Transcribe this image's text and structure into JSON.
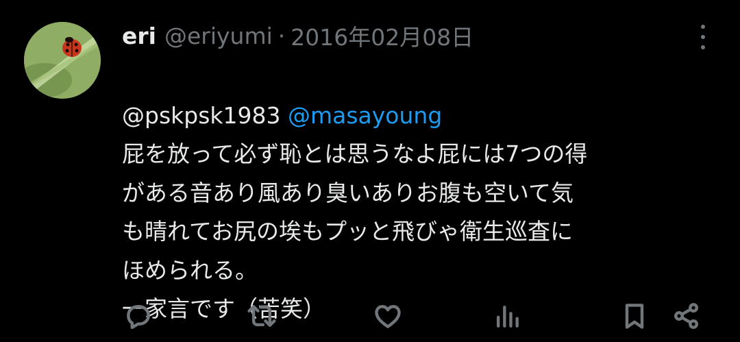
{
  "tweet": {
    "display_name": "eri",
    "handle": "@eriyumi",
    "separator": "·",
    "date": "2016年02月08日",
    "reply_to_1": "@pskpsk1983",
    "reply_to_2": "@masayoung",
    "text": "屁を放って必ず恥とは思うなよ屁には7つの得\nがある音あり風あり臭いありお腹も空いて気\nも晴れてお尻の埃もプッと飛びゃ衛生巡査に\nほめられる。\n一家言です（苦笑）"
  },
  "icons": {
    "avatar": "ladybug-on-leaf",
    "more": "more-vertical-icon",
    "reply": "reply-icon",
    "retweet": "retweet-icon",
    "like": "heart-icon",
    "views": "views-icon",
    "bookmark": "bookmark-icon",
    "share": "share-icon"
  },
  "colors": {
    "background": "#000000",
    "text": "#e7e9ea",
    "muted": "#71767b",
    "link": "#1d9bf0"
  }
}
